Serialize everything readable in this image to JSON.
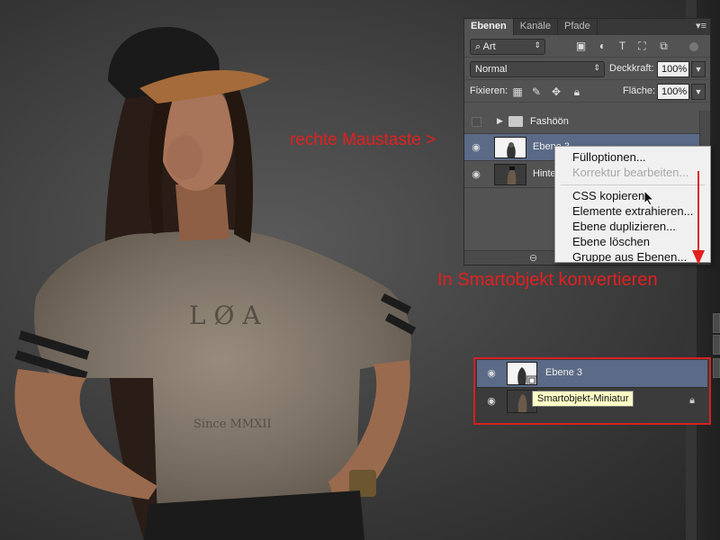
{
  "panel": {
    "tabs": [
      "Ebenen",
      "Kanäle",
      "Pfade"
    ],
    "menu_icon": "panel-menu-icon",
    "filter_kind": "Art",
    "filter_icons": [
      "image-filter-icon",
      "adjustment-filter-icon",
      "type-filter-icon",
      "shape-filter-icon",
      "smartobject-filter-icon"
    ],
    "blend_mode": "Normal",
    "opacity_label": "Deckkraft:",
    "opacity_value": "100%",
    "lock_label": "Fixieren:",
    "fill_label": "Fläche:",
    "fill_value": "100%",
    "layers": [
      {
        "name": "Fashöön",
        "type": "group",
        "visible": false
      },
      {
        "name": "Ebene 3",
        "type": "layer",
        "visible": true,
        "selected": true
      },
      {
        "name": "Hintergrund",
        "type": "layer",
        "visible": true
      }
    ]
  },
  "context_menu": {
    "items": [
      {
        "label": "Fülloptionen...",
        "enabled": true
      },
      {
        "label": "Korrektur bearbeiten...",
        "enabled": false
      },
      {
        "separator": true
      },
      {
        "label": "CSS kopieren",
        "enabled": true
      },
      {
        "label": "Elemente extrahieren...",
        "enabled": true
      },
      {
        "label": "Ebene duplizieren...",
        "enabled": true
      },
      {
        "label": "Ebene löschen",
        "enabled": true
      },
      {
        "label": "Gruppe aus Ebenen...",
        "enabled": true
      }
    ]
  },
  "annotations": {
    "right_click": "rechte Maustaste >",
    "convert": "In Smartobjekt konvertieren"
  },
  "inset": {
    "layers": [
      {
        "name": "Ebene 3",
        "selected": true,
        "smart_object": true
      },
      {
        "name": "",
        "locked": true
      }
    ],
    "tooltip": "Smartobjekt-Miniatur"
  },
  "colors": {
    "annotation": "#e22020",
    "selected_layer": "#5b6a87",
    "panel_bg": "#535353"
  }
}
